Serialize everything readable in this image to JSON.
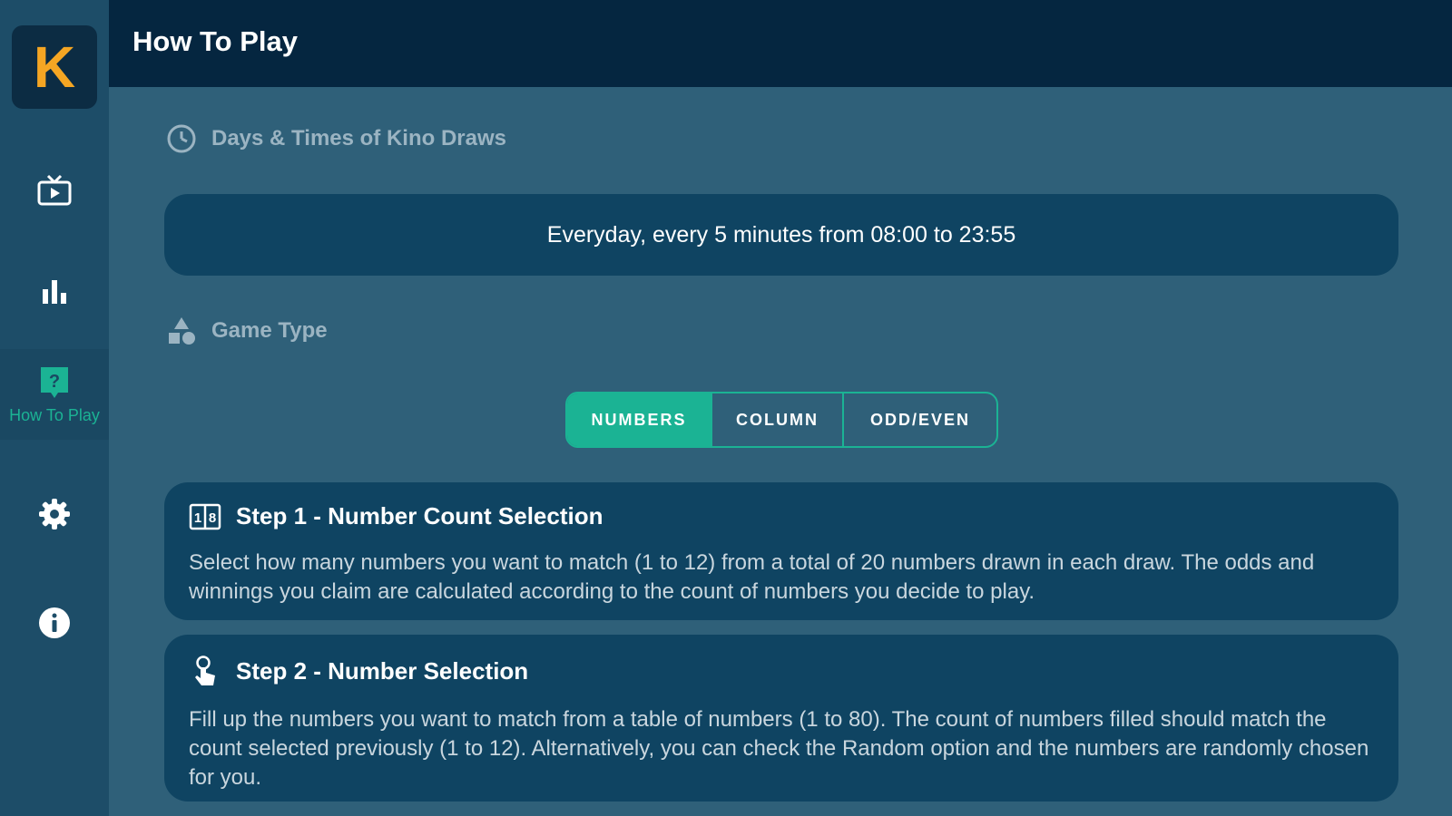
{
  "app": {
    "logo_letter": "K",
    "brand_color": "#f5a623",
    "accent_color": "#1bb394"
  },
  "header": {
    "title": "How To Play"
  },
  "sidebar": {
    "items": [
      {
        "icon": "tv-icon",
        "label": ""
      },
      {
        "icon": "bar-chart-icon",
        "label": ""
      },
      {
        "icon": "help-icon",
        "label": "How To Play",
        "active": true
      },
      {
        "icon": "gear-icon",
        "label": ""
      },
      {
        "icon": "info-icon",
        "label": ""
      }
    ]
  },
  "draw_times": {
    "heading": "Days & Times of Kino Draws",
    "text": "Everyday, every 5 minutes from 08:00 to 23:55"
  },
  "game_type": {
    "heading": "Game Type",
    "tabs": [
      {
        "label": "NUMBERS",
        "active": true
      },
      {
        "label": "COLUMN",
        "active": false
      },
      {
        "label": "ODD/EVEN",
        "active": false
      }
    ]
  },
  "steps": [
    {
      "icon": "number-grid-icon",
      "title": "Step 1 - Number Count Selection",
      "body": "Select how many numbers you want to match (1 to 12) from a total of 20 numbers drawn in each draw. The odds and winnings you claim are calculated according to the count of numbers you decide to play."
    },
    {
      "icon": "hand-pointer-icon",
      "title": "Step 2 - Number Selection",
      "body": "Fill up the numbers you want to match from a table of numbers (1 to 80). The count of numbers filled should match the count selected previously (1 to 12). Alternatively, you can check the Random option and the numbers are randomly chosen for you."
    }
  ]
}
